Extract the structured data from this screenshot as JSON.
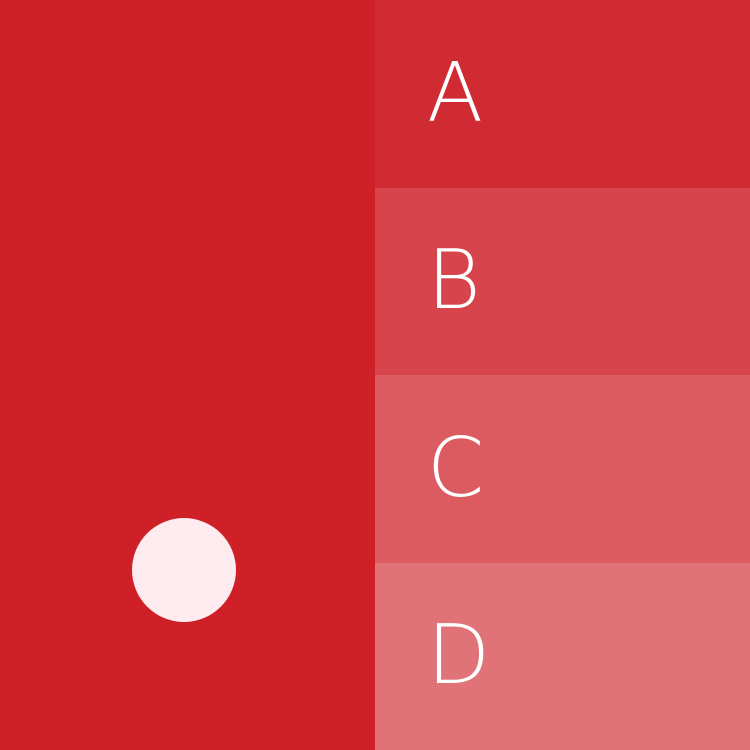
{
  "colors": {
    "main_panel": "#cf2027",
    "dot": "#fdebef",
    "label_text": "#ffffff"
  },
  "options": [
    {
      "label": "A",
      "color": "#d02b33"
    },
    {
      "label": "B",
      "color": "#d8444b"
    },
    {
      "label": "C",
      "color": "#dc5b61"
    },
    {
      "label": "D",
      "color": "#e07378"
    }
  ]
}
